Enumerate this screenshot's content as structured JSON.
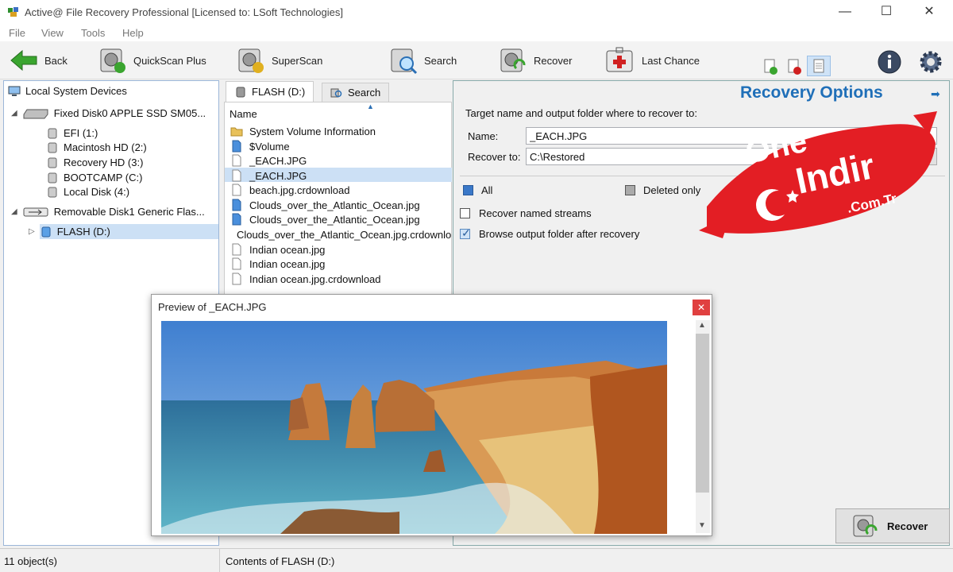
{
  "window": {
    "title": "Active@ File Recovery Professional [Licensed to: LSoft Technologies]",
    "minimize": "—",
    "maximize": "☐",
    "close": "✕"
  },
  "menu": [
    "File",
    "View",
    "Tools",
    "Help"
  ],
  "toolbar": {
    "back": "Back",
    "quickscan": "QuickScan Plus",
    "superscan": "SuperScan",
    "search": "Search",
    "recover": "Recover",
    "lastchance": "Last Chance"
  },
  "tree": {
    "root": "Local System Devices",
    "disk0": "Fixed Disk0 APPLE SSD SM05...",
    "disk0_parts": [
      "EFI (1:)",
      "Macintosh HD (2:)",
      "Recovery HD (3:)",
      "BOOTCAMP (C:)",
      "Local Disk (4:)"
    ],
    "disk1": "Removable Disk1 Generic Flas...",
    "disk1_parts": [
      "FLASH (D:)"
    ]
  },
  "tabs": {
    "flash": "FLASH (D:)",
    "search": "Search"
  },
  "files": {
    "column_name": "Name",
    "items": [
      "System Volume Information",
      "$Volume",
      "_EACH.JPG",
      "_EACH.JPG",
      "beach.jpg.crdownload",
      "Clouds_over_the_Atlantic_Ocean.jpg",
      "Clouds_over_the_Atlantic_Ocean.jpg",
      "Clouds_over_the_Atlantic_Ocean.jpg.crdownload",
      "Indian ocean.jpg",
      "Indian ocean.jpg",
      "Indian ocean.jpg.crdownload"
    ]
  },
  "options": {
    "title": "Recovery Options",
    "target_label": "Target name and output folder where to recover to:",
    "name_label": "Name:",
    "name_value": "_EACH.JPG",
    "recover_to_label": "Recover to:",
    "recover_to_value": "C:\\Restored",
    "all": "All",
    "deleted_only": "Deleted only",
    "named_streams": "Recover named streams",
    "browse_after": "Browse output folder after recovery",
    "recover_button": "Recover"
  },
  "preview": {
    "title": "Preview of _EACH.JPG",
    "close": "✕"
  },
  "status": {
    "objects": "11 object(s)",
    "contents": "Contents of FLASH (D:)"
  },
  "watermark": {
    "line1": "One",
    "line2": "Indir",
    "line3": ".Com.Tr"
  },
  "colors": {
    "accent": "#1f6fb8",
    "selected_row": "#cce0f5",
    "watermark_red": "#e31e24"
  }
}
